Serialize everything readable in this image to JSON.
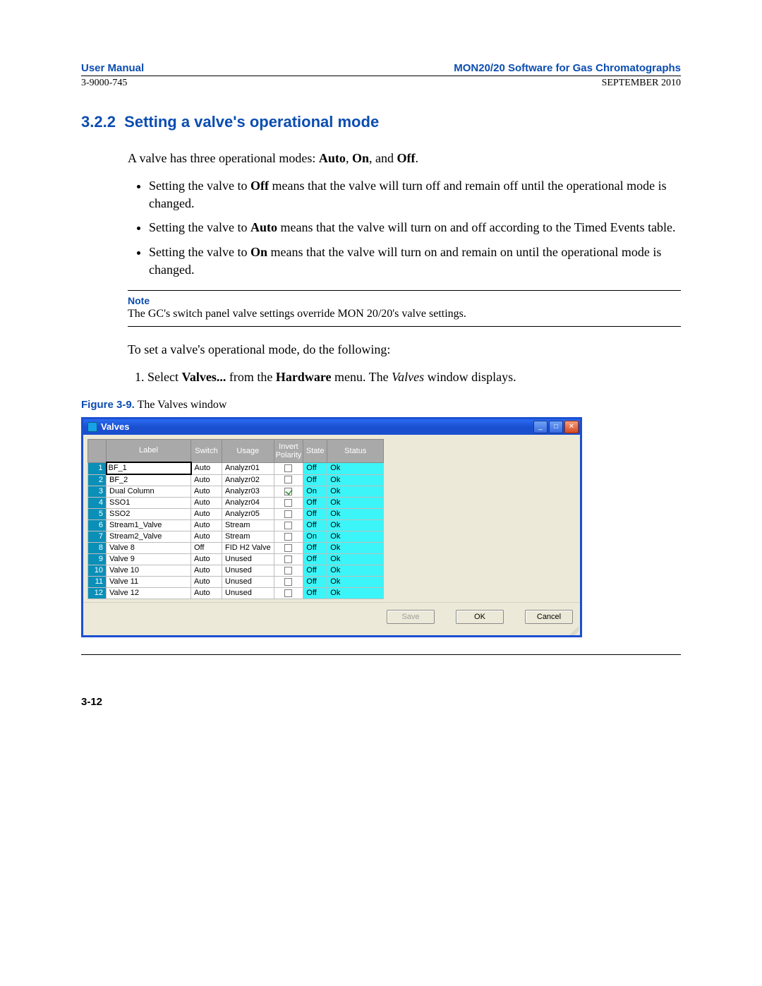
{
  "header": {
    "left": "User Manual",
    "right": "MON20/20 Software for Gas Chromatographs",
    "docnum": "3-9000-745",
    "date": "SEPTEMBER 2010"
  },
  "section": {
    "number": "3.2.2",
    "title": "Setting a valve's operational mode"
  },
  "intro_a": "A valve has three operational modes: ",
  "intro_modes": {
    "auto": "Auto",
    "on": "On",
    "off": "Off"
  },
  "intro_and": ", and ",
  "intro_comma_sep": ", ",
  "intro_period": ".",
  "bullets": {
    "b1a": "Setting the valve to ",
    "b1bold": "Off",
    "b1b": " means that the valve will turn off and remain off until the operational mode is changed.",
    "b2a": "Setting the valve to ",
    "b2bold": "Auto",
    "b2b": " means that the valve will turn on and off according to the Timed Events table.",
    "b3a": "Setting the valve to ",
    "b3bold": "On",
    "b3b": " means that the valve will turn on and remain on until the operational mode is changed."
  },
  "note": {
    "label": "Note",
    "text": "The GC's switch panel valve settings override MON 20/20's valve settings."
  },
  "pre_steps": "To set a valve's operational mode, do the following:",
  "steps": {
    "s1a": "Select ",
    "s1bold1": "Valves...",
    "s1b": " from the ",
    "s1bold2": "Hardware",
    "s1c": " menu.  The ",
    "s1ital": "Valves",
    "s1d": " window displays."
  },
  "figure": {
    "label": "Figure 3-9.",
    "caption": "  The Valves window"
  },
  "window": {
    "title": "Valves",
    "buttons": {
      "save": "Save",
      "ok": "OK",
      "cancel": "Cancel"
    },
    "columns": {
      "label": "Label",
      "switch": "Switch",
      "usage": "Usage",
      "invert": "Invert Polarity",
      "state": "State",
      "status": "Status"
    },
    "rows": [
      {
        "n": "1",
        "label": "BF_1",
        "switch": "Auto",
        "usage": "Analyzr01",
        "invert": false,
        "state": "Off",
        "status": "Ok"
      },
      {
        "n": "2",
        "label": "BF_2",
        "switch": "Auto",
        "usage": "Analyzr02",
        "invert": false,
        "state": "Off",
        "status": "Ok"
      },
      {
        "n": "3",
        "label": "Dual Column",
        "switch": "Auto",
        "usage": "Analyzr03",
        "invert": true,
        "state": "On",
        "status": "Ok"
      },
      {
        "n": "4",
        "label": "SSO1",
        "switch": "Auto",
        "usage": "Analyzr04",
        "invert": false,
        "state": "Off",
        "status": "Ok"
      },
      {
        "n": "5",
        "label": "SSO2",
        "switch": "Auto",
        "usage": "Analyzr05",
        "invert": false,
        "state": "Off",
        "status": "Ok"
      },
      {
        "n": "6",
        "label": "Stream1_Valve",
        "switch": "Auto",
        "usage": "Stream",
        "invert": false,
        "state": "Off",
        "status": "Ok"
      },
      {
        "n": "7",
        "label": "Stream2_Valve",
        "switch": "Auto",
        "usage": "Stream",
        "invert": false,
        "state": "On",
        "status": "Ok"
      },
      {
        "n": "8",
        "label": "Valve 8",
        "switch": "Off",
        "usage": "FID H2 Valve",
        "invert": false,
        "state": "Off",
        "status": "Ok"
      },
      {
        "n": "9",
        "label": "Valve 9",
        "switch": "Auto",
        "usage": "Unused",
        "invert": false,
        "state": "Off",
        "status": "Ok"
      },
      {
        "n": "10",
        "label": "Valve 10",
        "switch": "Auto",
        "usage": "Unused",
        "invert": false,
        "state": "Off",
        "status": "Ok"
      },
      {
        "n": "11",
        "label": "Valve 11",
        "switch": "Auto",
        "usage": "Unused",
        "invert": false,
        "state": "Off",
        "status": "Ok"
      },
      {
        "n": "12",
        "label": "Valve 12",
        "switch": "Auto",
        "usage": "Unused",
        "invert": false,
        "state": "Off",
        "status": "Ok"
      }
    ]
  },
  "footer": "3-12"
}
